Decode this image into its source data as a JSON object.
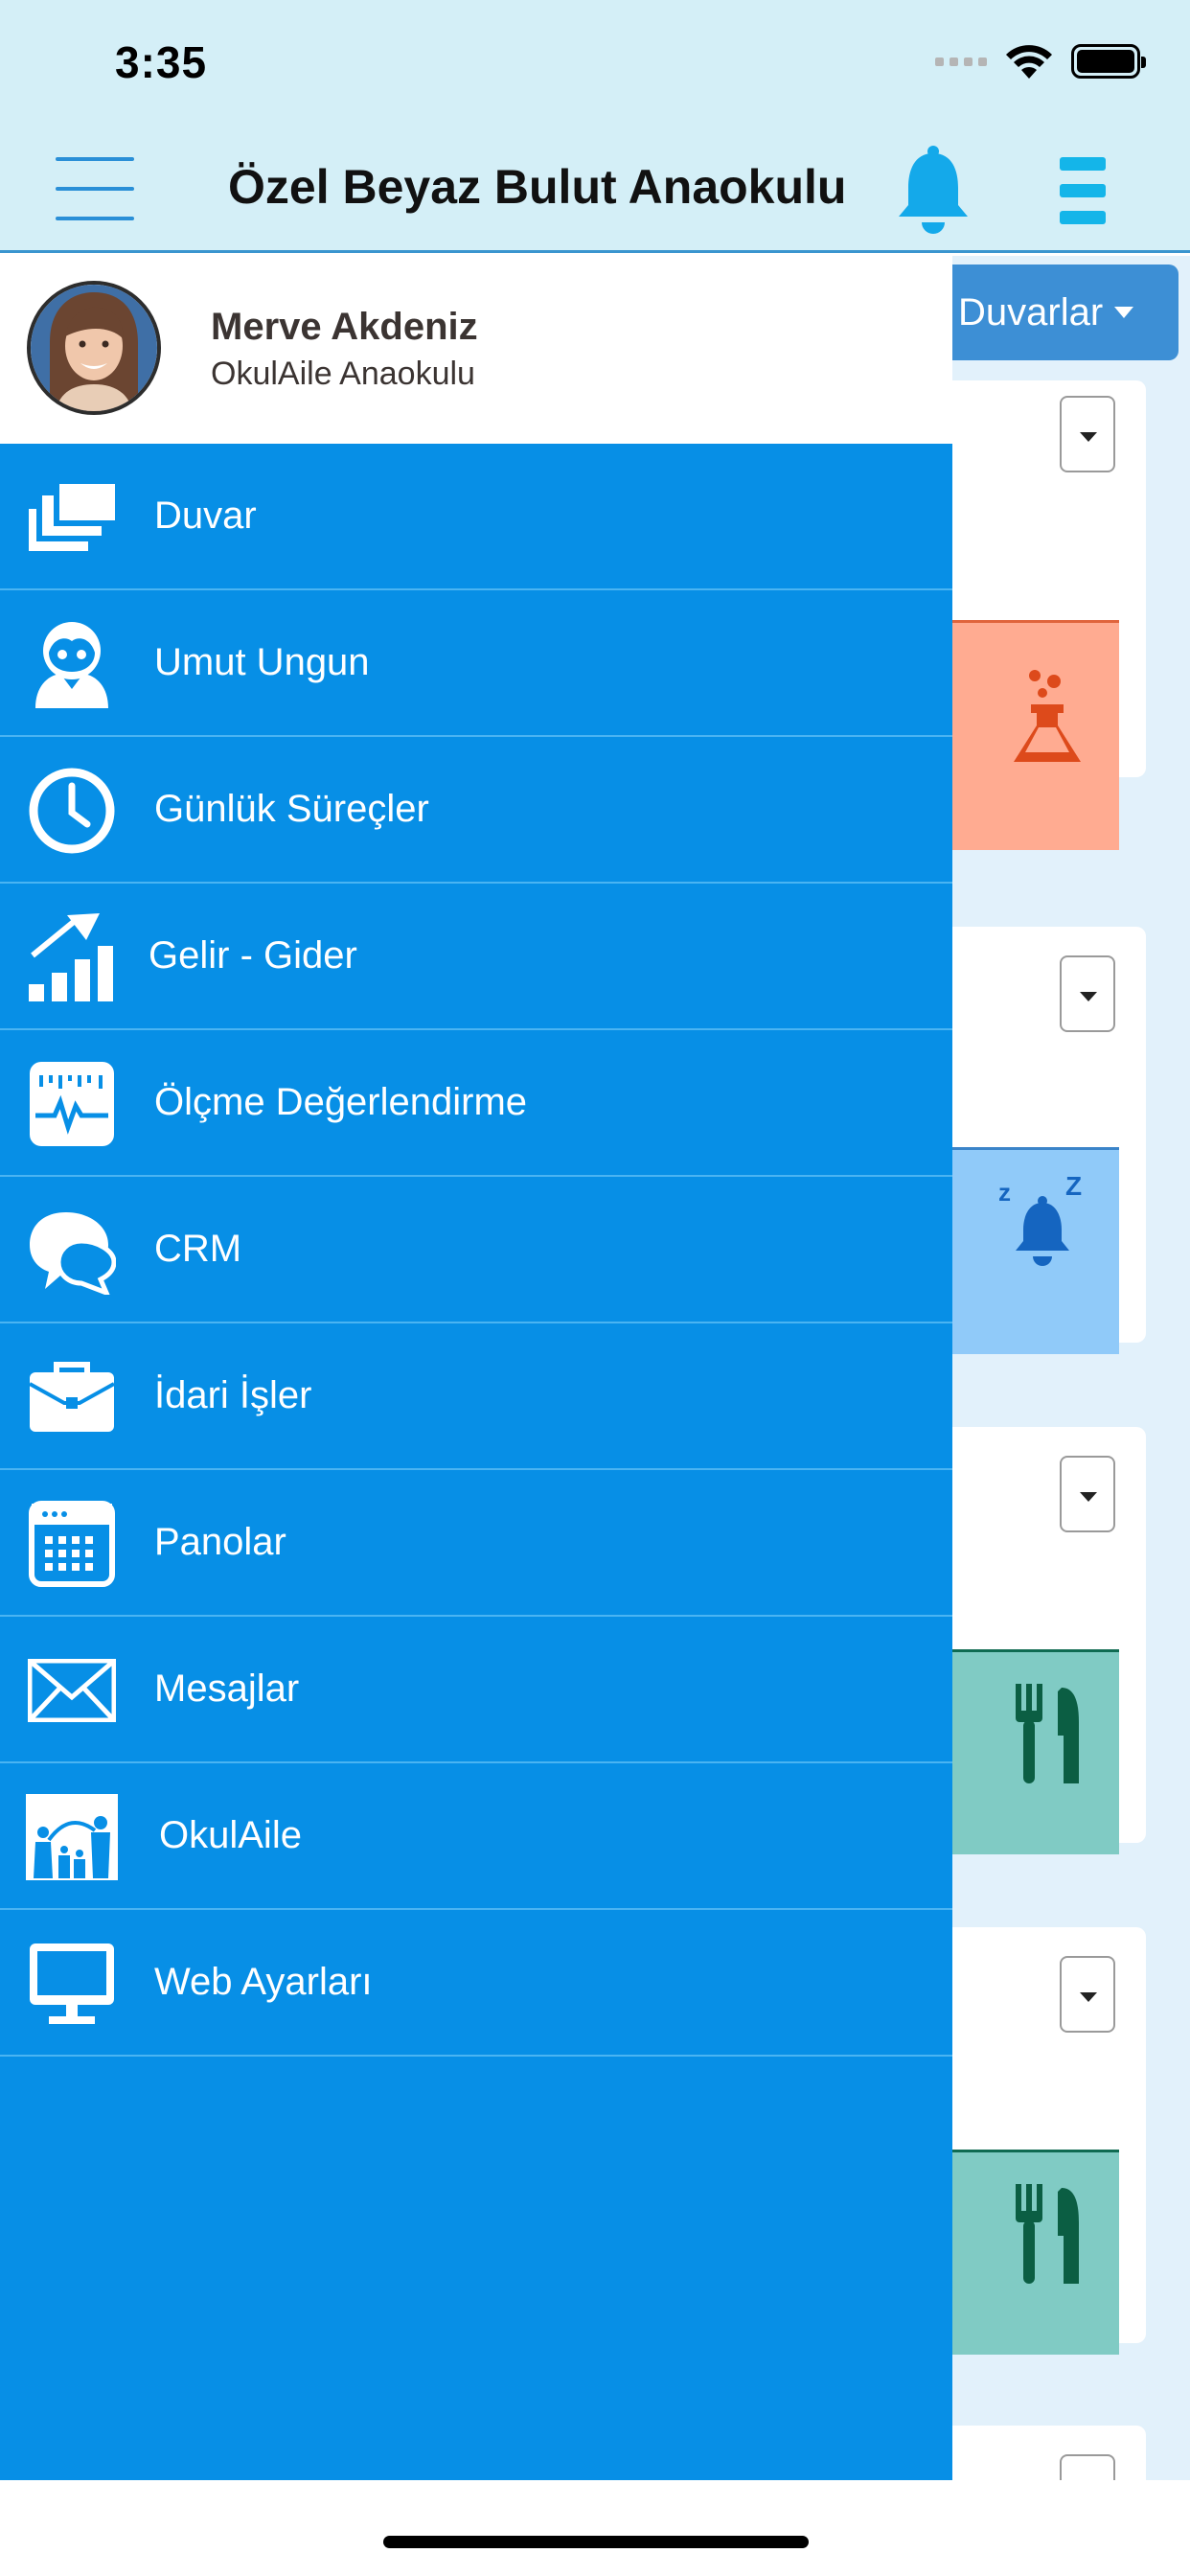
{
  "status_bar": {
    "time": "3:35"
  },
  "nav": {
    "title": "Özel Beyaz Bulut Anaokulu"
  },
  "wall": {
    "dropdown_label": "Duvarlar"
  },
  "profile": {
    "name": "Merve Akdeniz",
    "school": "OkulAile Anaokulu"
  },
  "menu": [
    {
      "label": "Duvar",
      "icon": "layers-icon"
    },
    {
      "label": "Umut Ungun",
      "icon": "child-icon"
    },
    {
      "label": "Günlük Süreçler",
      "icon": "clock-icon"
    },
    {
      "label": "Gelir - Gider",
      "icon": "growth-chart-icon"
    },
    {
      "label": "Ölçme Değerlendirme",
      "icon": "pulse-monitor-icon"
    },
    {
      "label": "CRM",
      "icon": "chat-bubbles-icon"
    },
    {
      "label": "İdari İşler",
      "icon": "briefcase-icon"
    },
    {
      "label": "Panolar",
      "icon": "calendar-icon"
    },
    {
      "label": "Mesajlar",
      "icon": "envelope-icon"
    },
    {
      "label": "OkulAile",
      "icon": "family-icon"
    },
    {
      "label": "Web Ayarları",
      "icon": "monitor-icon"
    }
  ],
  "colors": {
    "drawer": "#078fe6",
    "header": "#d4eff7",
    "card_science": "#ffab91",
    "card_sleep": "#90caf9",
    "card_food": "#80cbc4"
  }
}
